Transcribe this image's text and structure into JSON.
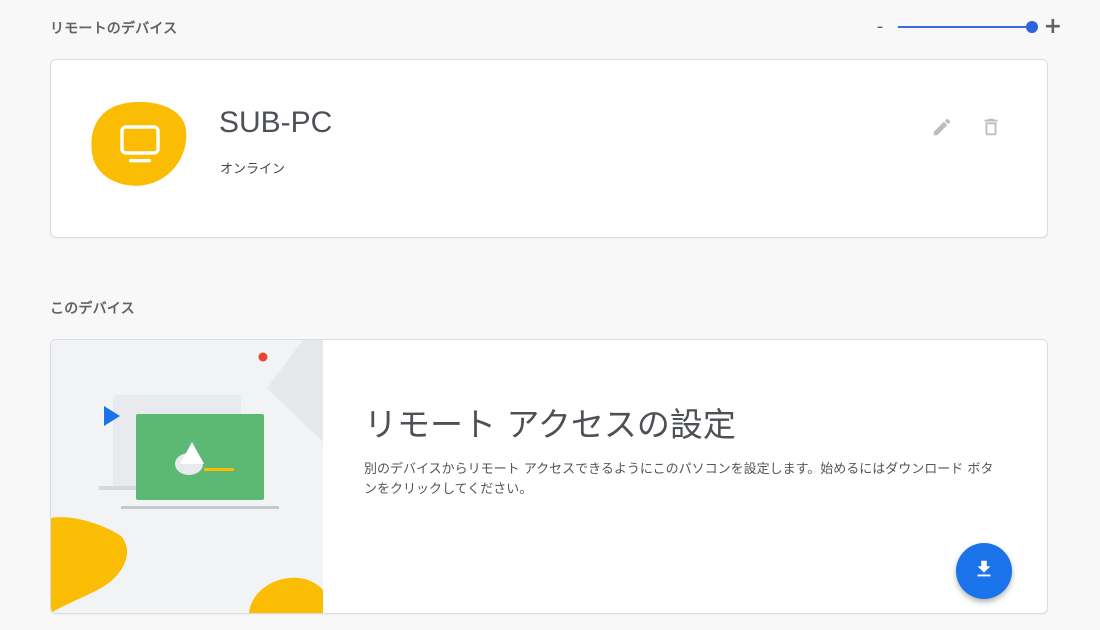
{
  "remote": {
    "section_title": "リモートのデバイス",
    "zoom": {
      "minus_label": "-",
      "plus_label": "+",
      "level": 1.0
    },
    "devices": [
      {
        "name": "SUB-PC",
        "status": "オンライン",
        "icon": "monitor-icon",
        "actions": [
          "edit-icon",
          "delete-icon"
        ]
      }
    ]
  },
  "this_device": {
    "section_title": "このデバイス",
    "heading": "リモート アクセスの設定",
    "description": "別のデバイスからリモート アクセスできるようにこのパソコンを設定します。始めるにはダウンロード ボタンをクリックしてください。",
    "download_icon": "download-icon"
  },
  "colors": {
    "accent_yellow": "#fbbc04",
    "fab_blue": "#1a73e8",
    "slider_blue": "#2f62e0",
    "illus_green": "#5bb974"
  }
}
